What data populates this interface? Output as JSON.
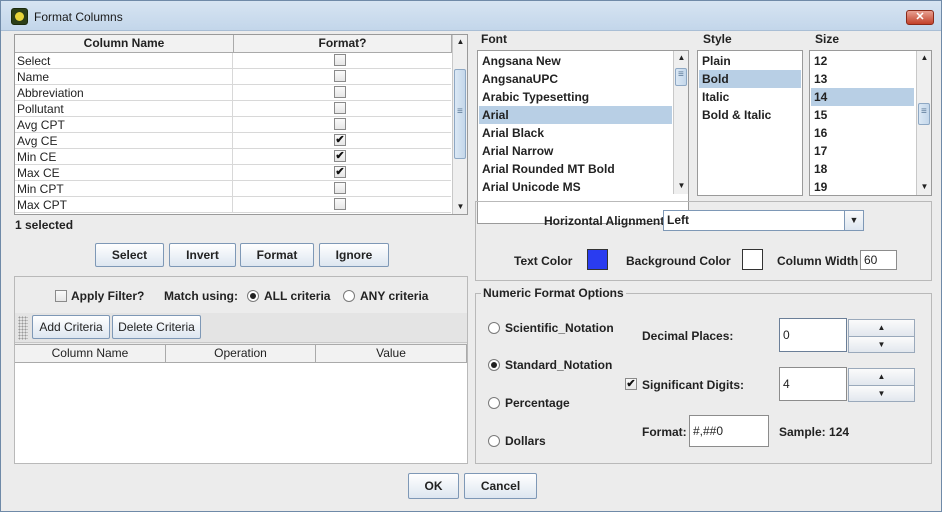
{
  "window": {
    "title": "Format Columns",
    "close_label": "✕"
  },
  "columns_table": {
    "headers": [
      "Column Name",
      "Format?"
    ],
    "rows": [
      {
        "name": "Select",
        "checked": false
      },
      {
        "name": "Name",
        "checked": false
      },
      {
        "name": "Abbreviation",
        "checked": false
      },
      {
        "name": "Pollutant",
        "checked": false
      },
      {
        "name": "Avg CPT",
        "checked": false
      },
      {
        "name": "Avg CE",
        "checked": true
      },
      {
        "name": "Min CE",
        "checked": true
      },
      {
        "name": "Max CE",
        "checked": true
      },
      {
        "name": "Min CPT",
        "checked": false
      },
      {
        "name": "Max CPT",
        "checked": false
      }
    ],
    "status": "1 selected"
  },
  "column_buttons": {
    "select": "Select",
    "invert": "Invert",
    "format": "Format",
    "ignore": "Ignore"
  },
  "filter": {
    "apply_label": "Apply Filter?",
    "match_label": "Match using:",
    "all_label": "ALL criteria",
    "any_label": "ANY criteria",
    "add_label": "Add Criteria",
    "delete_label": "Delete Criteria",
    "headers": [
      "Column Name",
      "Operation",
      "Value"
    ]
  },
  "font": {
    "font_title": "Font",
    "style_title": "Style",
    "size_title": "Size",
    "fonts": [
      "Angsana New",
      "AngsanaUPC",
      "Arabic Typesetting",
      "Arial",
      "Arial Black",
      "Arial Narrow",
      "Arial Rounded MT Bold",
      "Arial Unicode MS"
    ],
    "selected_font": "Arial",
    "styles": [
      "Plain",
      "Bold",
      "Italic",
      "Bold & Italic"
    ],
    "selected_style": "Bold",
    "sizes": [
      "12",
      "13",
      "14",
      "15",
      "16",
      "17",
      "18",
      "19"
    ],
    "selected_size": "14"
  },
  "appearance": {
    "alignment_label": "Horizontal Alignment",
    "alignment_value": "Left",
    "text_color_label": "Text Color",
    "text_color": "#2a3cf0",
    "bg_color_label": "Background Color",
    "bg_color": "#ffffff",
    "width_label": "Column Width",
    "width_value": "60"
  },
  "numeric": {
    "group_title": "Numeric Format Options",
    "scientific": "Scientific_Notation",
    "standard": "Standard_Notation",
    "percentage": "Percentage",
    "dollars": "Dollars",
    "decimal_label": "Decimal Places:",
    "decimal_value": "0",
    "sig_label": "Significant Digits:",
    "sig_value": "4",
    "format_label": "Format:",
    "format_value": "#,##0",
    "sample_label": "Sample: 124"
  },
  "dialog_buttons": {
    "ok": "OK",
    "cancel": "Cancel"
  }
}
